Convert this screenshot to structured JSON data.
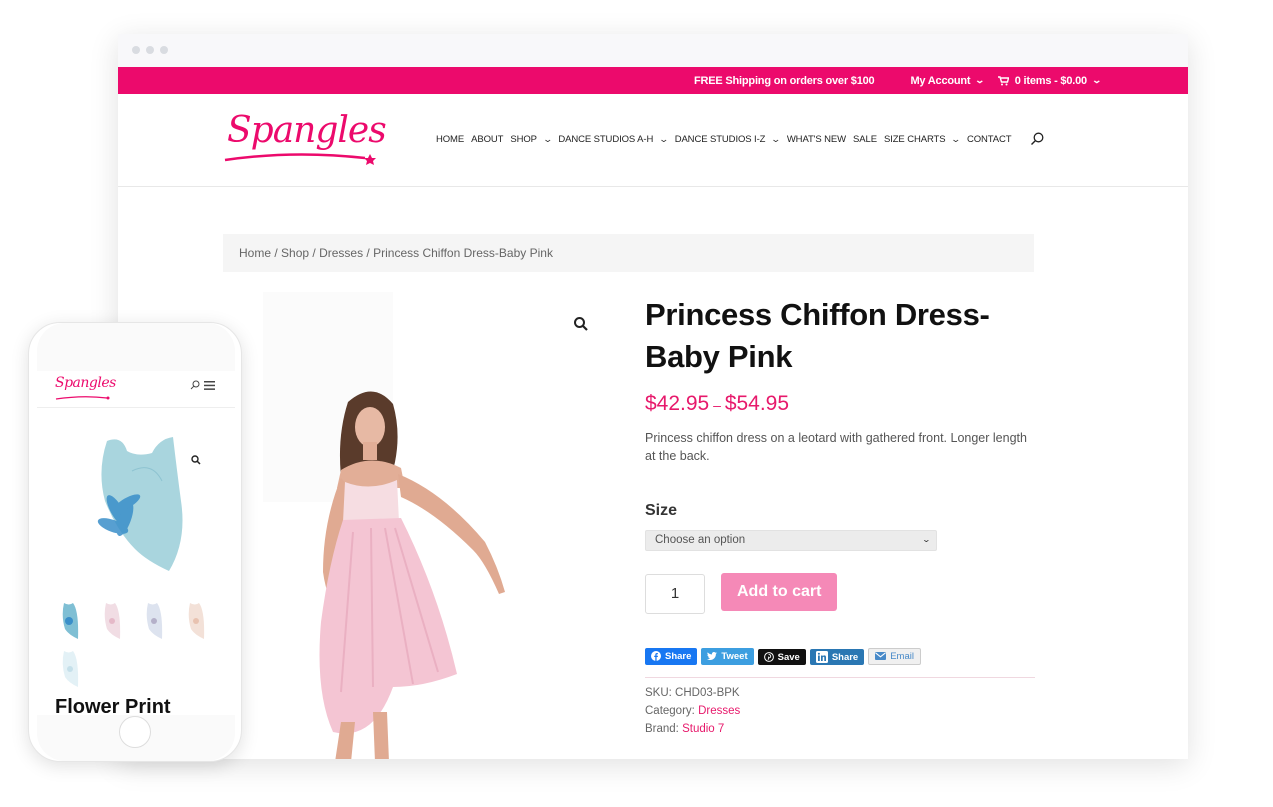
{
  "topbar": {
    "shipping": "FREE Shipping on orders over $100",
    "account": "My Account",
    "cart": "0 items - $0.00"
  },
  "brand": {
    "logo_text": "Spangles",
    "accent": "#ec0a6c",
    "price_color": "#e7196b"
  },
  "nav": {
    "items": [
      {
        "label": "HOME",
        "dropdown": false
      },
      {
        "label": "ABOUT",
        "dropdown": false
      },
      {
        "label": "SHOP",
        "dropdown": true
      },
      {
        "label": "DANCE STUDIOS A-H",
        "dropdown": true
      },
      {
        "label": "DANCE STUDIOS I-Z",
        "dropdown": true
      },
      {
        "label": "WHAT'S NEW",
        "dropdown": false
      },
      {
        "label": "SALE",
        "dropdown": false
      },
      {
        "label": "SIZE CHARTS",
        "dropdown": true
      },
      {
        "label": "CONTACT",
        "dropdown": false
      }
    ],
    "search_icon": "search-icon"
  },
  "breadcrumb": {
    "items": [
      "Home",
      "Shop",
      "Dresses"
    ],
    "separator": " / ",
    "current": "Princess Chiffon Dress-Baby Pink"
  },
  "product": {
    "title": "Princess Chiffon Dress-Baby Pink",
    "price_low": "$42.95",
    "price_sep": " – ",
    "price_high": "$54.95",
    "description": "Princess chiffon dress on a leotard with gathered front. Longer length at the back.",
    "size_label": "Size",
    "size_placeholder": "Choose an option",
    "quantity": "1",
    "add_to_cart": "Add to cart",
    "share_buttons": [
      {
        "label": "Share",
        "network": "facebook"
      },
      {
        "label": "Tweet",
        "network": "twitter"
      },
      {
        "label": "Save",
        "network": "pinterest"
      },
      {
        "label": "Share",
        "network": "linkedin"
      },
      {
        "label": "Email",
        "network": "email"
      }
    ],
    "sku_label": "SKU:",
    "sku": "CHD03-BPK",
    "category_label": "Category:",
    "category": "Dresses",
    "brand_label": "Brand:",
    "brand": "Studio 7",
    "image_alt": "Dancer in baby pink chiffon dress"
  },
  "phone": {
    "logo_text": "Spangles",
    "product_title": "Flower Print",
    "thumbnail_count": 5
  }
}
